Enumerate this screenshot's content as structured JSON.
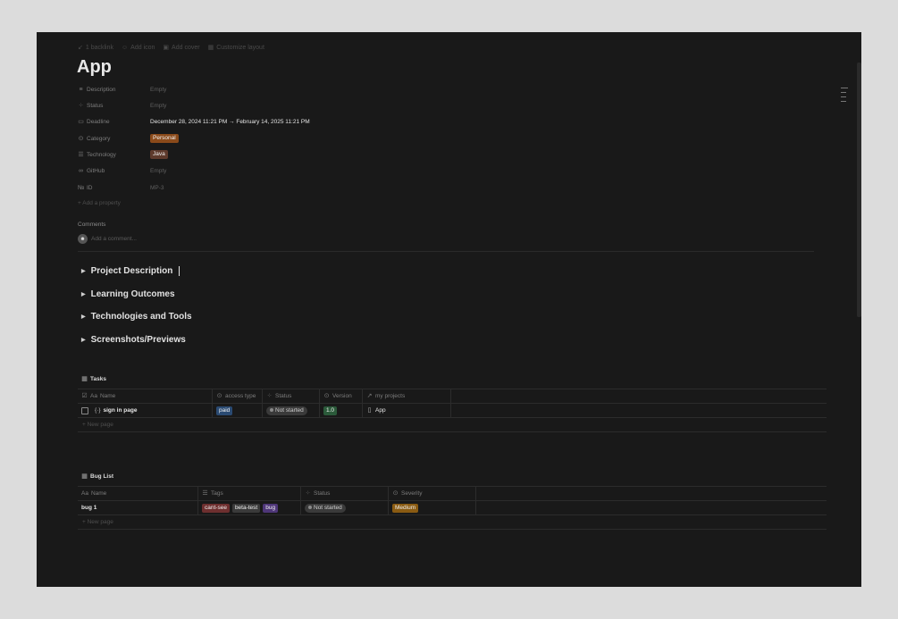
{
  "topbar": {
    "backlinks": "1 backlink",
    "add_icon": "Add icon",
    "add_cover": "Add cover",
    "customize": "Customize layout"
  },
  "page": {
    "title": "App"
  },
  "properties": [
    {
      "name": "Description",
      "icon": "text-lines-icon",
      "value": "Empty"
    },
    {
      "name": "Status",
      "icon": "status-spinner-icon",
      "value": "Empty"
    },
    {
      "name": "Deadline",
      "icon": "calendar-icon",
      "value": "December 28, 2024 11:21 PM → February 14, 2025 11:21 PM"
    },
    {
      "name": "Category",
      "icon": "select-circle-icon",
      "value": "Personal",
      "color": "#8a4a1a"
    },
    {
      "name": "Technology",
      "icon": "list-icon",
      "value": "Java",
      "color": "#5e3a2c"
    },
    {
      "name": "GitHub",
      "icon": "link-icon",
      "value": "Empty"
    },
    {
      "name": "ID",
      "icon": "number-icon",
      "icon_text": "№",
      "value": "MP-3"
    }
  ],
  "add_property": "Add a property",
  "comments": {
    "label": "Comments",
    "placeholder": "Add a comment..."
  },
  "toggles": [
    "Project Description",
    "Learning Outcomes",
    "Technologies and Tools",
    "Screenshots/Previews"
  ],
  "tasks": {
    "title": "Tasks",
    "columns": [
      "Name",
      "access type",
      "Status",
      "Version",
      "my projects"
    ],
    "name_prefix": "Aa",
    "rows": [
      {
        "name": "sign in page",
        "access_type": "paid",
        "status": "Not started",
        "version": "1.0",
        "project": "App"
      }
    ],
    "new_page": "New page"
  },
  "bugs": {
    "title": "Bug List",
    "columns": [
      "Name",
      "Tags",
      "Status",
      "Severity"
    ],
    "name_prefix": "Aa",
    "rows": [
      {
        "name": "bug 1",
        "tags": [
          "cant-see",
          "beta-test",
          "bug"
        ],
        "status": "Not started",
        "severity": "Medium"
      }
    ],
    "new_page": "New page"
  }
}
